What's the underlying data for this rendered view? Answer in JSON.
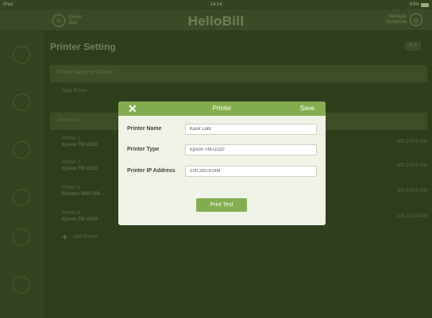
{
  "status_bar": {
    "device": "iPad",
    "time": "14:14",
    "battery": "63%"
  },
  "header": {
    "brand": "HelloBill",
    "store_icon_glyph": "◎",
    "store_name": "Demo",
    "store_sub": "Bali",
    "user_icon_glyph": "◎",
    "user_name": "Manager",
    "user_sub": "Notebook"
  },
  "sidebar": {
    "icons": [
      "menu-icon",
      "user-icon",
      "list-icon",
      "report-icon",
      "settings-icon",
      "help-icon"
    ]
  },
  "main": {
    "page_title": "Printer Setting",
    "top_button": "< >",
    "section1_text": "Printer Setting for Cashier",
    "data_printer_text": "Data Printer",
    "list_header_text": "Printer List",
    "printers": [
      {
        "name": "Printer 1",
        "type": "Epson TM-U220",
        "ip": "100.200.9.009"
      },
      {
        "name": "Printer 2",
        "type": "Epson TM-U220",
        "ip": "100.200.9.009"
      },
      {
        "name": "Printer 3",
        "type": "Bixolon SRP-350",
        "ip": "100.200.9.009"
      },
      {
        "name": "Printer 4",
        "type": "Epson TM-U220",
        "ip": "100.200.9.009"
      }
    ],
    "add_printer": "Add Printer"
  },
  "modal": {
    "close_glyph": "✕",
    "title": "Printer",
    "save_label": "Save",
    "fields": {
      "name_label": "Printer Name",
      "name_value": "Kasir Lobi",
      "type_label": "Printer Type",
      "type_value": "Epson TM-U220",
      "ip_label": "Printer IP Address",
      "ip_value": "100.200.9.009"
    },
    "print_test_label": "Print Test"
  }
}
